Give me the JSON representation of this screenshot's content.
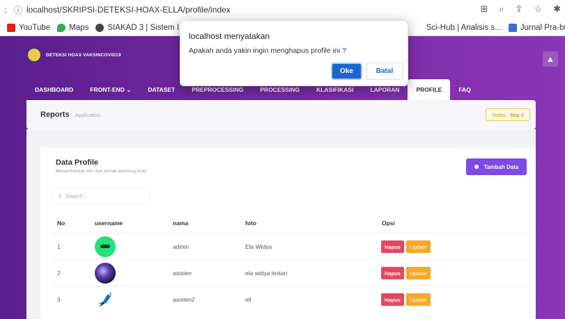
{
  "browser": {
    "url": "localhost/SKRIPSI-DETEKSI-HOAX-ELLA/profile/index",
    "bookmarks": [
      {
        "label": "YouTube",
        "color": "#e62117"
      },
      {
        "label": "Maps",
        "color": "#34a853"
      },
      {
        "label": "SIAKAD 3 | Sistem I...",
        "color": "#444444"
      },
      {
        "label": "Sci-Hub | Analisis s...",
        "color": ""
      },
      {
        "label": "Jurnal Pra-bukti",
        "color": "#3b6fd8"
      }
    ]
  },
  "app": {
    "brand": "DETEKSI HOAX VAKSINCOVID19",
    "nav": [
      "DASHBOARD",
      "FRONT-END",
      "DATASET",
      "PREPROCESSING",
      "PROCESSING",
      "KLASIFIKASI",
      "LAPORAN",
      "PROFILE",
      "FAQ"
    ],
    "nav_active": "PROFILE"
  },
  "reports": {
    "title": "Reports",
    "subtitle": "Application",
    "today_label": "Today:",
    "today_value": "Sep 1"
  },
  "profile": {
    "title": "Data Profile",
    "subtitle": "Menambahkan tim riset terkait labeleing hoax",
    "add_button": "Tambah Data",
    "search_placeholder": "Search...",
    "columns": [
      "No",
      "username",
      "nama",
      "foto",
      "Opsi"
    ],
    "rows": [
      {
        "no": "1",
        "username": "admin",
        "nama": "Ela Widya",
        "avatar": "green-face"
      },
      {
        "no": "2",
        "username": "asisten",
        "nama": "ela widya lestari",
        "avatar": "galaxy"
      },
      {
        "no": "3",
        "username": "asisten2",
        "nama": "ell",
        "avatar": "bird"
      }
    ],
    "delete_label": "Hapus",
    "update_label": "Update"
  },
  "dialog": {
    "title": "localhost menyatakan",
    "message": "Apakah anda yakin ingin menghapus profile ini ?",
    "ok": "Oke",
    "cancel": "Batal"
  }
}
